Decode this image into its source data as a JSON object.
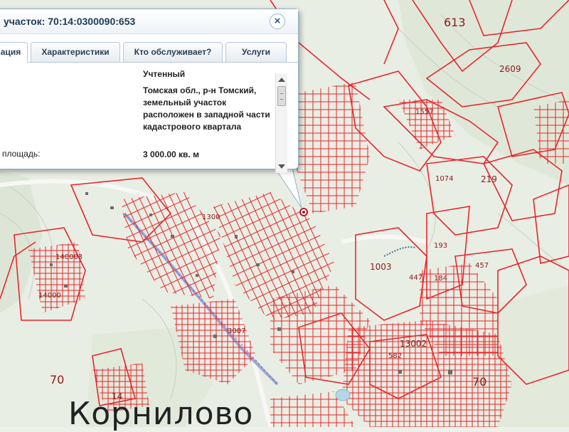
{
  "popup": {
    "title": "участок: 70:14:0300090:653",
    "close_icon": "close-icon",
    "tabs": [
      {
        "label": "ация",
        "active": true
      },
      {
        "label": "Характеристики",
        "active": false
      },
      {
        "label": "Кто обслуживает?",
        "active": false
      },
      {
        "label": "Услуги",
        "active": false
      }
    ],
    "rows": {
      "status_value": "Учтенный",
      "address_value": "Томская обл., р-н Томский, земельный участок расположен в западной части кадастрового квартала",
      "area_label": "площадь:",
      "area_value": "3 000.00 кв. м"
    }
  },
  "map": {
    "place_name": "Корнилово",
    "parcel_color": "#e8262b",
    "labels": {
      "n613": "613",
      "n2609": "2609",
      "n1557": "1557",
      "n219": "219",
      "n1074": "1074",
      "n193": "193",
      "n1003": "1003",
      "n447": "447",
      "n184": "184",
      "n457": "457",
      "n1300": "1300",
      "n13002": "13002",
      "n70a": "70",
      "n70b": "70",
      "n14": "14",
      "n140003": "140003",
      "n14000": "14000",
      "n582": "582",
      "n3007": "3007"
    }
  }
}
